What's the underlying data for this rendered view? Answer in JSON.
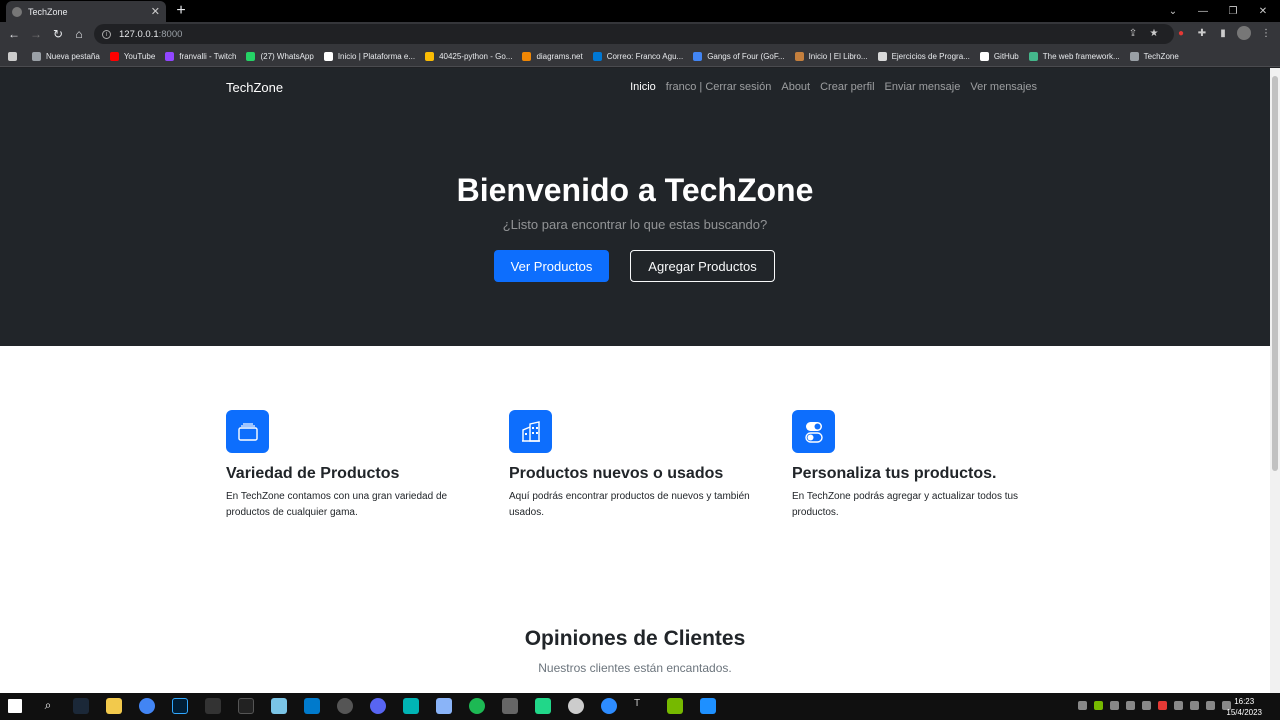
{
  "browser": {
    "tab_title": "TechZone",
    "url_host": "127.0.0.1",
    "url_port": ":8000",
    "bookmarks": [
      {
        "label": "",
        "color": "#cccccc"
      },
      {
        "label": "Nueva pestaña",
        "color": "#9aa0a6"
      },
      {
        "label": "YouTube",
        "color": "#ff0000"
      },
      {
        "label": "franvalli - Twitch",
        "color": "#9146ff"
      },
      {
        "label": "(27) WhatsApp",
        "color": "#25d366"
      },
      {
        "label": "Inicio | Plataforma e...",
        "color": "#ffffff"
      },
      {
        "label": "40425-python - Go...",
        "color": "#fbbc04"
      },
      {
        "label": "diagrams.net",
        "color": "#f08705"
      },
      {
        "label": "Correo: Franco Agu...",
        "color": "#0078d4"
      },
      {
        "label": "Gangs of Four (GoF...",
        "color": "#4285f4"
      },
      {
        "label": "Inicio | El Libro...",
        "color": "#c47f3d"
      },
      {
        "label": "Ejercicios de Progra...",
        "color": "#d9d9d9"
      },
      {
        "label": "GitHub",
        "color": "#ffffff"
      },
      {
        "label": "The web framework...",
        "color": "#44b78b"
      },
      {
        "label": "TechZone",
        "color": "#9aa0a6"
      }
    ]
  },
  "navbar": {
    "brand": "TechZone",
    "links": [
      "Inicio",
      "franco | Cerrar sesión",
      "About",
      "Crear perfil",
      "Enviar mensaje",
      "Ver mensajes"
    ]
  },
  "hero": {
    "title": "Bienvenido a TechZone",
    "subtitle": "¿Listo para encontrar lo que estas buscando?",
    "primary_button": "Ver Productos",
    "secondary_button": "Agregar Productos"
  },
  "features": [
    {
      "icon": "collection-icon",
      "title": "Variedad de Productos",
      "text": "En TechZone contamos con una gran variedad de productos de cualquier gama."
    },
    {
      "icon": "building-icon",
      "title": "Productos nuevos o usados",
      "text": "Aquí podrás encontrar productos de nuevos y también usados."
    },
    {
      "icon": "toggles-icon",
      "title": "Personaliza tus productos.",
      "text": "En TechZone podrás agregar y actualizar todos tus productos."
    }
  ],
  "reviews": {
    "title": "Opiniones de Clientes",
    "subtitle": "Nuestros clientes están encantados."
  },
  "taskbar": {
    "time": "16:23",
    "date": "15/4/2023"
  },
  "colors": {
    "primary": "#0d6efd",
    "dark": "#212529"
  }
}
